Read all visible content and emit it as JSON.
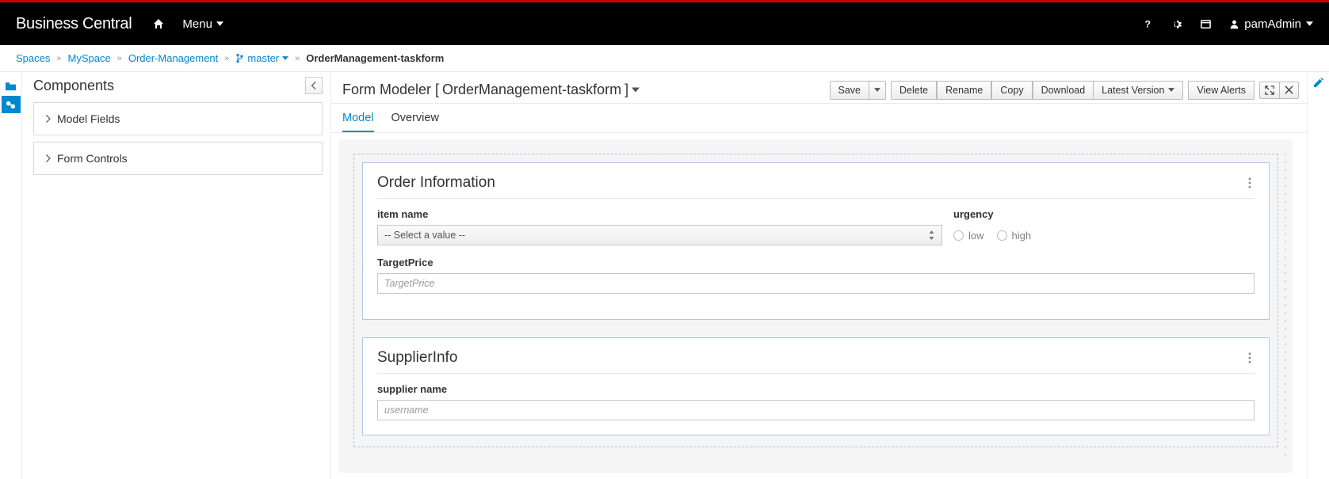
{
  "header": {
    "brand": "Business Central",
    "menu_label": "Menu",
    "user_label": "pamAdmin"
  },
  "breadcrumb": {
    "items": [
      "Spaces",
      "MySpace",
      "Order-Management"
    ],
    "branch": "master",
    "current": "OrderManagement-taskform"
  },
  "components": {
    "title": "Components",
    "items": [
      "Model Fields",
      "Form Controls"
    ]
  },
  "editor": {
    "title_prefix": "Form Modeler [",
    "title_name": "OrderManagement-taskform",
    "title_suffix": "]",
    "toolbar": {
      "save": "Save",
      "delete": "Delete",
      "rename": "Rename",
      "copy": "Copy",
      "download": "Download",
      "latest_version": "Latest Version",
      "view_alerts": "View Alerts"
    },
    "tabs": {
      "model": "Model",
      "overview": "Overview"
    }
  },
  "form": {
    "panel1": {
      "title": "Order Information",
      "item_name_label": "item name",
      "item_name_placeholder": "-- Select a value --",
      "urgency_label": "urgency",
      "urgency_option_low": "low",
      "urgency_option_high": "high",
      "target_price_label": "TargetPrice",
      "target_price_placeholder": "TargetPrice"
    },
    "panel2": {
      "title": "SupplierInfo",
      "supplier_name_label": "supplier name",
      "supplier_name_placeholder": "username"
    }
  }
}
